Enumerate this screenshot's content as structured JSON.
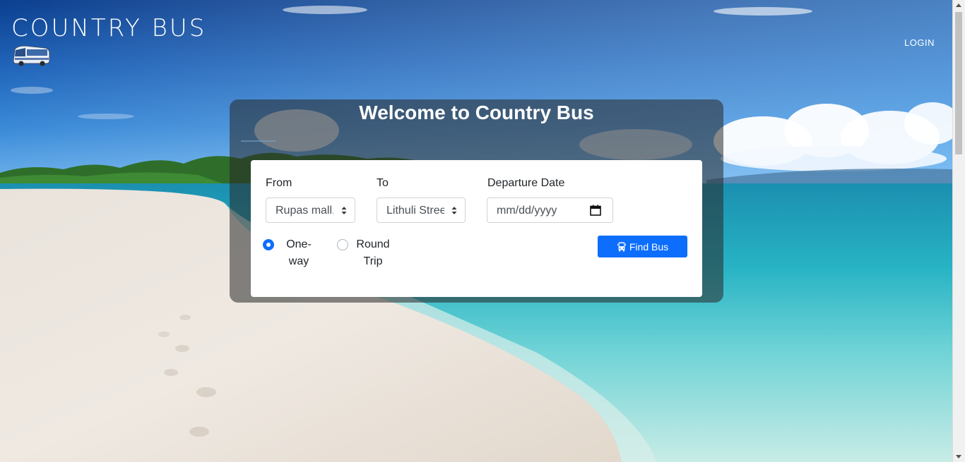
{
  "brand": {
    "title": "COUNTRY BUS",
    "logo_icon": "bus-icon"
  },
  "nav": {
    "login_label": "LOGIN"
  },
  "panel": {
    "title": "Welcome to Country Bus"
  },
  "search": {
    "from_label": "From",
    "from_value": "Rupas mall,",
    "to_label": "To",
    "to_value": "Lithuli Stree",
    "date_label": "Departure Date",
    "date_placeholder": "mm/dd/yyyy",
    "trip_options": [
      {
        "label": "One-way",
        "checked": true
      },
      {
        "label": "Round Trip",
        "checked": false
      }
    ],
    "find_label": "Find Bus",
    "find_icon": "bus-icon",
    "date_icon": "calendar-icon"
  },
  "colors": {
    "accent": "#0d6efd",
    "panel_overlay": "rgba(40,40,40,0.55)"
  }
}
